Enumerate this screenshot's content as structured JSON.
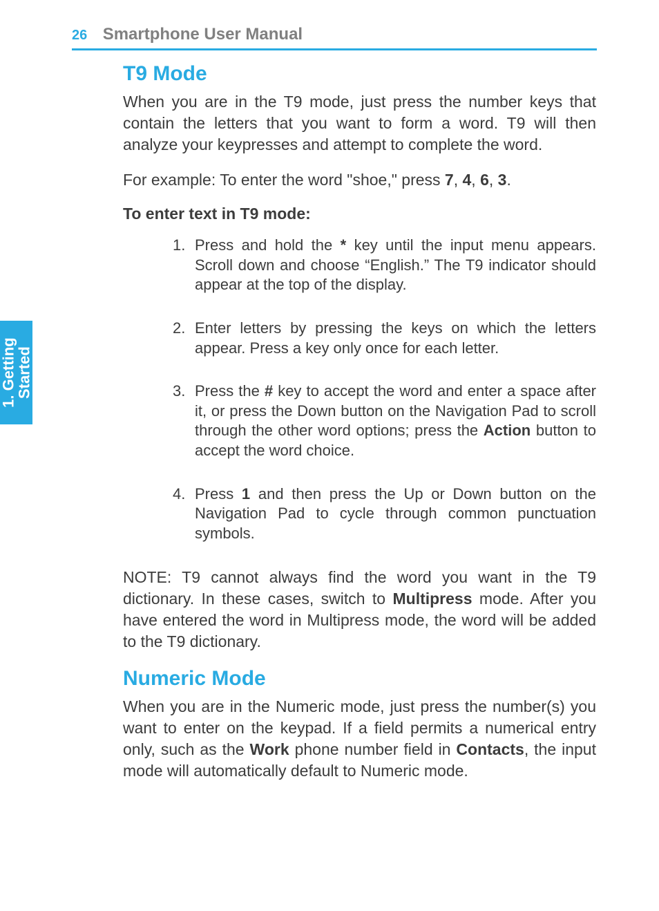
{
  "header": {
    "page_number": "26",
    "title": "Smartphone User Manual"
  },
  "side_tab": {
    "line1": "1. Getting",
    "line2": "Started"
  },
  "section1": {
    "heading": "T9 Mode",
    "para1": "When you are in the T9 mode, just press the number keys that contain the letters that you want to form a word.  T9 will then analyze your keypresses and attempt to complete the word.",
    "para2_prefix": "For example:  To enter the word \"shoe,\" press ",
    "para2_keys": [
      "7",
      "4",
      "6",
      "3"
    ],
    "subhead": "To enter text in T9 mode:",
    "steps": [
      {
        "num": "1.",
        "pre": "Press and hold the ",
        "bold1": "*",
        "mid": " key until the input menu appears.  Scroll down and choose “English.”  The T9 indicator should appear at the top of the display."
      },
      {
        "num": "2.",
        "text": "Enter letters by pressing the keys on which the letters appear.  Press a key only once for each letter."
      },
      {
        "num": "3.",
        "pre": "Press the ",
        "bold1": "#",
        "mid": " key to accept the word and enter a space after it, or press the Down button on the Navigation Pad to scroll through the other word options; press the ",
        "bold2": "Action",
        "post": " button to accept the word choice."
      },
      {
        "num": "4.",
        "pre": "Press ",
        "bold1": "1",
        "mid": " and then press the Up or Down button on the Navigation Pad to cycle through common punctuation symbols."
      }
    ],
    "note_pre": "NOTE:   T9 cannot always find the word you want in the T9 dictionary.  In these cases, switch to ",
    "note_bold": "Multipress",
    "note_post": " mode.  After you have entered the word in Multipress mode, the word will be added to the T9 dictionary."
  },
  "section2": {
    "heading": "Numeric Mode",
    "para_pre": "When you are in the Numeric mode, just press the number(s) you want to enter on the keypad.  If a field permits a nu­merical entry only, such as the ",
    "bold1": "Work",
    "mid": " phone number field in ",
    "bold2": "Contacts",
    "post": ", the input mode will automatically default to Numeric mode."
  }
}
